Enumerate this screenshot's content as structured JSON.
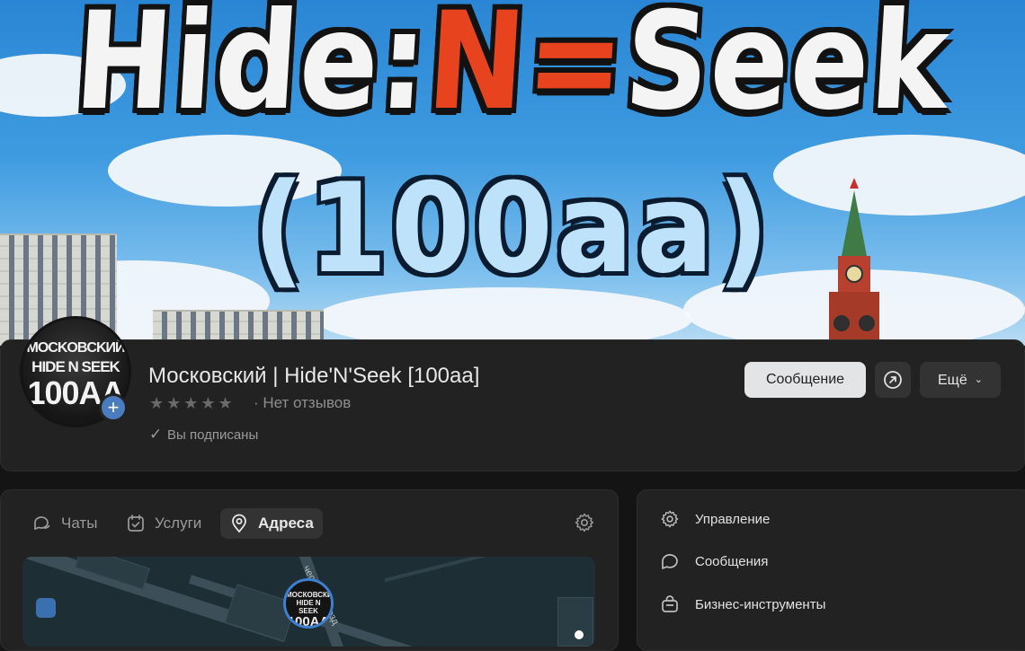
{
  "cover": {
    "title_part1": "Hide",
    "title_sep1": ":",
    "title_part2": "N",
    "title_sep2": "=",
    "title_part3": "Seek",
    "subtitle": "(100aa)"
  },
  "group": {
    "avatar_line1": "MOCKOBCKИЙ",
    "avatar_line2": "HIDE N SEEK",
    "avatar_line3": "100AA",
    "avatar_plus": "+",
    "name": "Московский | Hide'N'Seek [100aa]",
    "stars": "★★★★★",
    "reviews": "· Нет отзывов",
    "subscribed": "Вы подписаны"
  },
  "actions": {
    "message": "Сообщение",
    "more": "Ещё"
  },
  "tabs": [
    {
      "label": "Чаты",
      "active": false
    },
    {
      "label": "Услуги",
      "active": false
    },
    {
      "label": "Адреса",
      "active": true
    }
  ],
  "map": {
    "street": "ческий проезд",
    "pin_line1": "МОСКОВСКИЙ HIDE N SEEK",
    "pin_line2": "100AA"
  },
  "menu": [
    {
      "label": "Управление",
      "icon": "gear-icon"
    },
    {
      "label": "Сообщения",
      "icon": "chat-bubble-icon"
    },
    {
      "label": "Бизнес-инструменты",
      "icon": "bag-icon"
    }
  ],
  "colors": {
    "accent": "#4a7cc0",
    "title_red": "#e8431f",
    "card_bg": "#222222"
  }
}
